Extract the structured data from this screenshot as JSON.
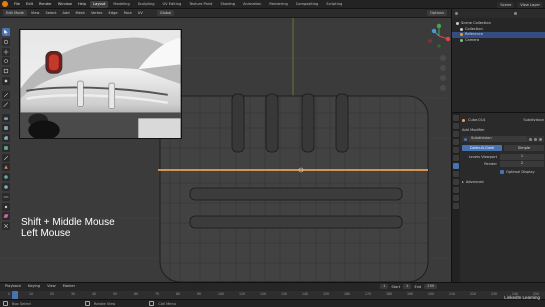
{
  "app": {
    "menus": [
      "File",
      "Edit",
      "Render",
      "Window",
      "Help"
    ],
    "workspaces": [
      "Layout",
      "Modeling",
      "Sculpting",
      "UV Editing",
      "Texture Paint",
      "Shading",
      "Animation",
      "Rendering",
      "Compositing",
      "Scripting"
    ],
    "active_workspace": "Layout",
    "scene_label": "Scene",
    "view_layer_label": "View Layer",
    "accent_color": "#e87d0d",
    "select_color": "#4772b3"
  },
  "viewport": {
    "mode_label": "Edit Mode",
    "header_menus": [
      "View",
      "Select",
      "Add",
      "Mesh",
      "Vertex",
      "Edge",
      "Face",
      "UV"
    ],
    "transform_orientation": "Global",
    "options_label": "Options",
    "overlay_lines": [
      "Shift + Middle Mouse",
      "Left Mouse"
    ],
    "gizmo_axes": [
      "X",
      "Y",
      "Z"
    ]
  },
  "outliner": {
    "title": "Scene Collection",
    "items": [
      {
        "label": "Scene Collection",
        "color": "#d8d8d8"
      },
      {
        "label": "Collection",
        "color": "#d8d8d8"
      },
      {
        "label": "Reference",
        "color": "#e0a040"
      },
      {
        "label": "Camera",
        "color": "#80c080"
      }
    ],
    "selected_index": 2
  },
  "properties": {
    "object_name": "Cube.014",
    "modifier_label": "Subdivision",
    "add_modifier_label": "Add Modifier",
    "catmull_label": "Catmull-Clark",
    "simple_label": "Simple",
    "levels_viewport_label": "Levels Viewport",
    "levels_viewport_value": "1",
    "render_label": "Render",
    "render_value": "2",
    "optimal_display_label": "Optimal Display",
    "advanced_label": "Advanced"
  },
  "timeline": {
    "menus": [
      "Playback",
      "Keying",
      "View",
      "Marker"
    ],
    "start_label": "Start",
    "start_value": "1",
    "end_label": "End",
    "end_value": "250",
    "current_frame": "1",
    "ticks": [
      "0",
      "10",
      "20",
      "30",
      "40",
      "50",
      "60",
      "70",
      "80",
      "90",
      "100",
      "110",
      "120",
      "130",
      "140",
      "150",
      "160",
      "170",
      "180",
      "190",
      "200",
      "210",
      "220",
      "230",
      "240",
      "250"
    ]
  },
  "statusbar": {
    "items": [
      "Box Select",
      "Rotate View",
      "Call Menu"
    ]
  },
  "watermark": "LinkedIn Learning"
}
